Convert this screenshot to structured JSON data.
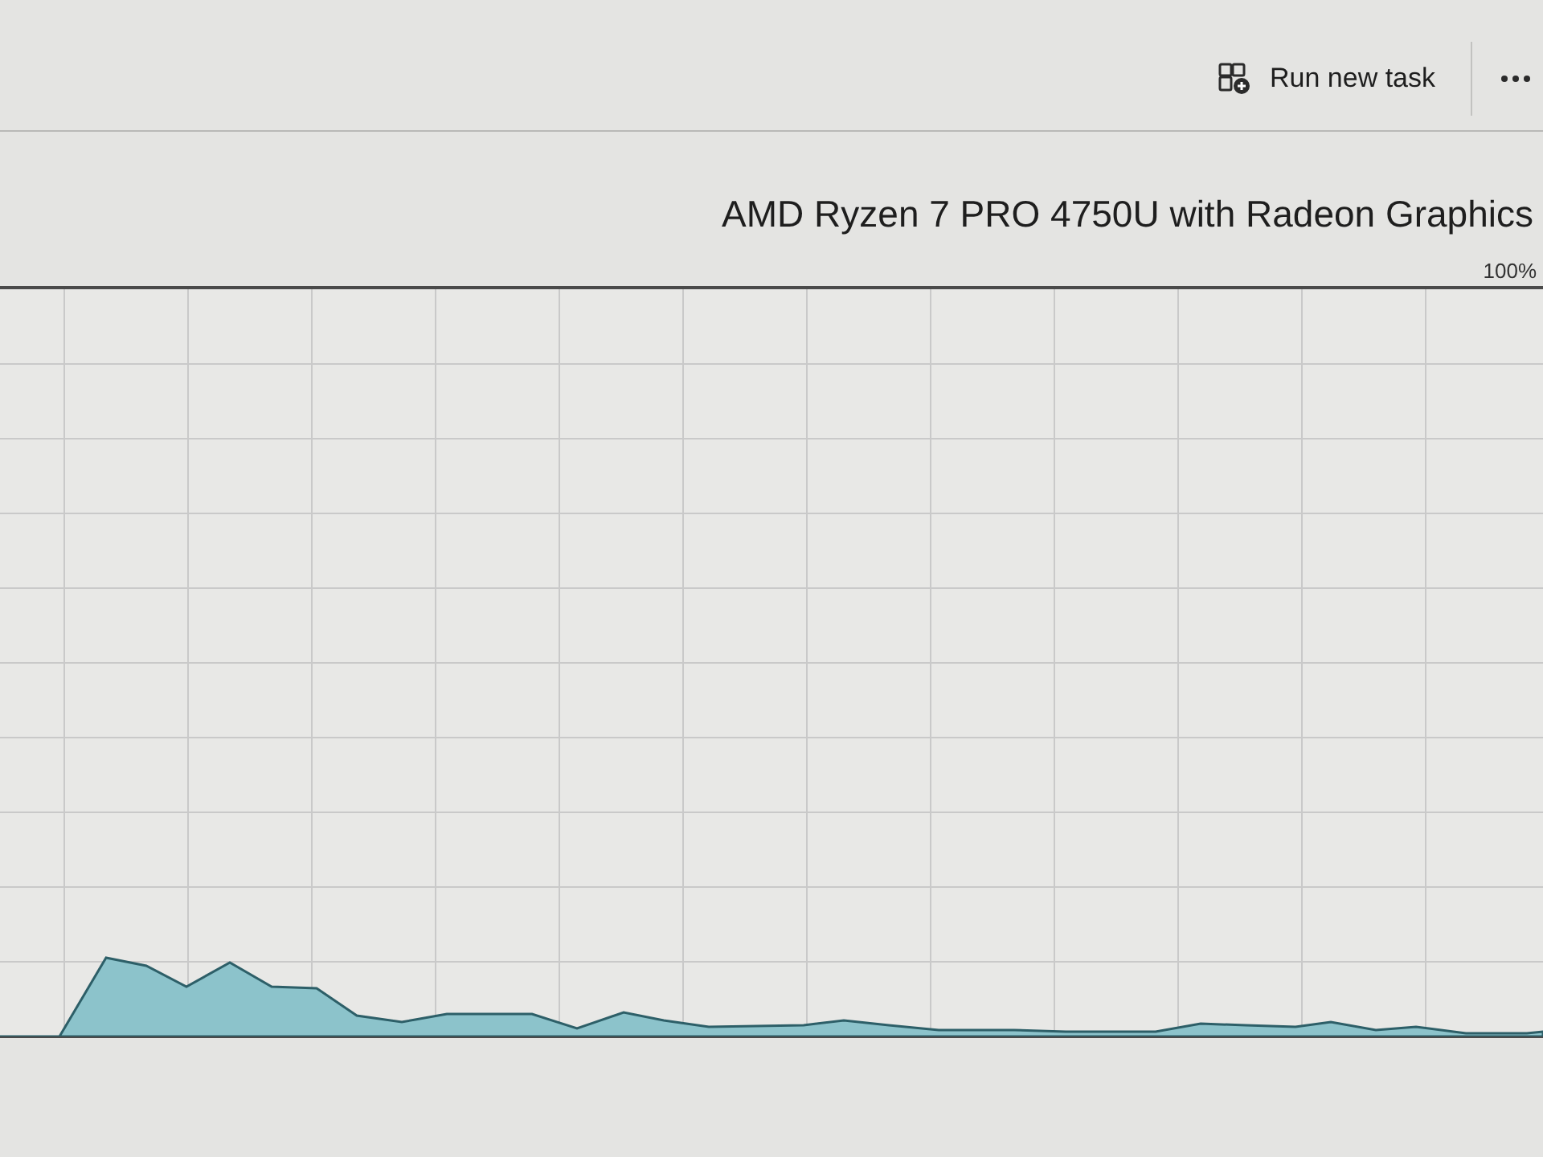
{
  "toolbar": {
    "run_task_button": {
      "label": "Run new task"
    }
  },
  "header": {
    "processor_name": "AMD Ryzen 7 PRO 4750U with Radeon Graphics"
  },
  "graph": {
    "max_label": "100%"
  }
}
